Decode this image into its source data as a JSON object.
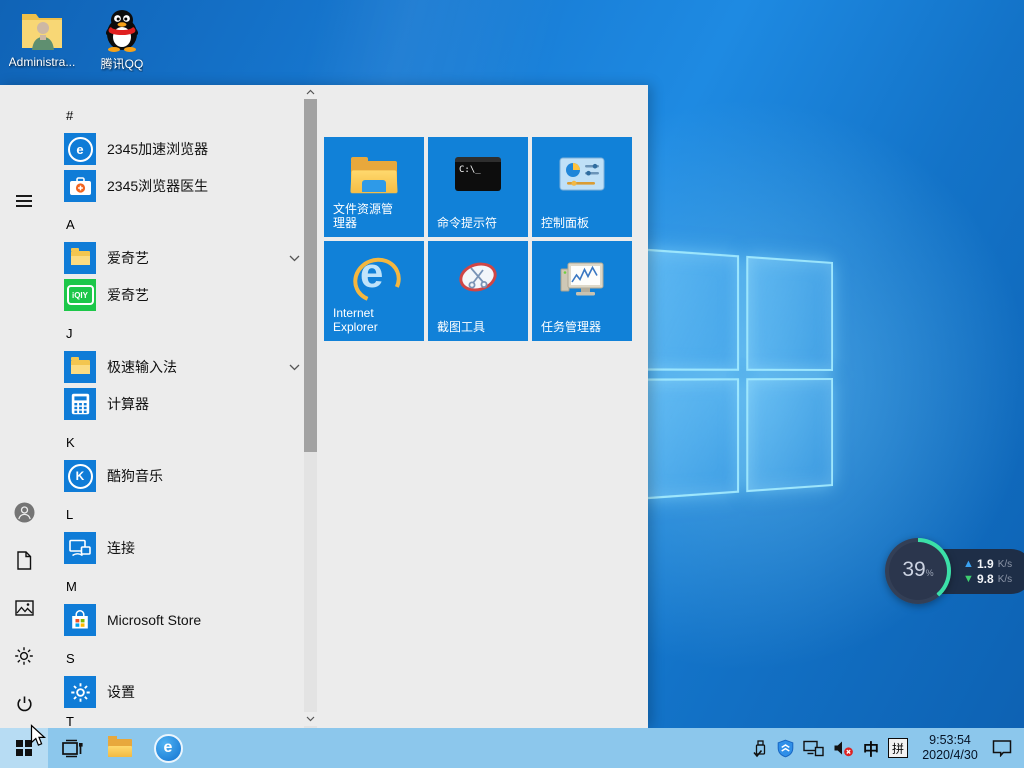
{
  "colors": {
    "accent": "#0f7cd7",
    "tile_blue": "#1181d8",
    "taskbar": "#8cc7ec",
    "iqiyi_green": "#1cc749",
    "arc_green": "#3be0a8",
    "up_arrow_blue": "#3aa2f2",
    "down_arrow_green": "#3ecf70"
  },
  "desktop": {
    "icons": [
      {
        "label": "Administra..."
      },
      {
        "label": "腾讯QQ"
      }
    ]
  },
  "start_menu": {
    "app_list": [
      {
        "type": "section",
        "label": "#"
      },
      {
        "type": "app",
        "label": "2345加速浏览器",
        "icon_letter": "e"
      },
      {
        "type": "app",
        "label": "2345浏览器医生"
      },
      {
        "type": "section",
        "label": "A"
      },
      {
        "type": "folder",
        "label": "爱奇艺"
      },
      {
        "type": "app",
        "label": "爱奇艺",
        "icon_letter": "iQIY"
      },
      {
        "type": "section",
        "label": "J"
      },
      {
        "type": "folder",
        "label": "极速输入法"
      },
      {
        "type": "app",
        "label": "计算器"
      },
      {
        "type": "section",
        "label": "K"
      },
      {
        "type": "app",
        "label": "酷狗音乐",
        "icon_letter": "K"
      },
      {
        "type": "section",
        "label": "L"
      },
      {
        "type": "app",
        "label": "连接"
      },
      {
        "type": "section",
        "label": "M"
      },
      {
        "type": "app",
        "label": "Microsoft Store"
      },
      {
        "type": "section",
        "label": "S"
      },
      {
        "type": "app",
        "label": "设置"
      },
      {
        "type": "section",
        "label": "T"
      }
    ],
    "tiles": [
      {
        "label": "文件资源管理器"
      },
      {
        "label": "命令提示符",
        "icon_text": "C:\\_"
      },
      {
        "label": "控制面板"
      },
      {
        "label": "Internet Explorer",
        "icon_letter": "e"
      },
      {
        "label": "截图工具"
      },
      {
        "label": "任务管理器"
      }
    ]
  },
  "taskbar": {
    "browser_letter": "e"
  },
  "tray": {
    "ime_lang": "中",
    "ime_mode": "拼",
    "clock": {
      "time": "9:53:54",
      "date": "2020/4/30"
    }
  },
  "net_widget": {
    "percent": "39",
    "percent_unit": "%",
    "up_value": "1.9",
    "down_value": "9.8",
    "unit": "K/s"
  }
}
